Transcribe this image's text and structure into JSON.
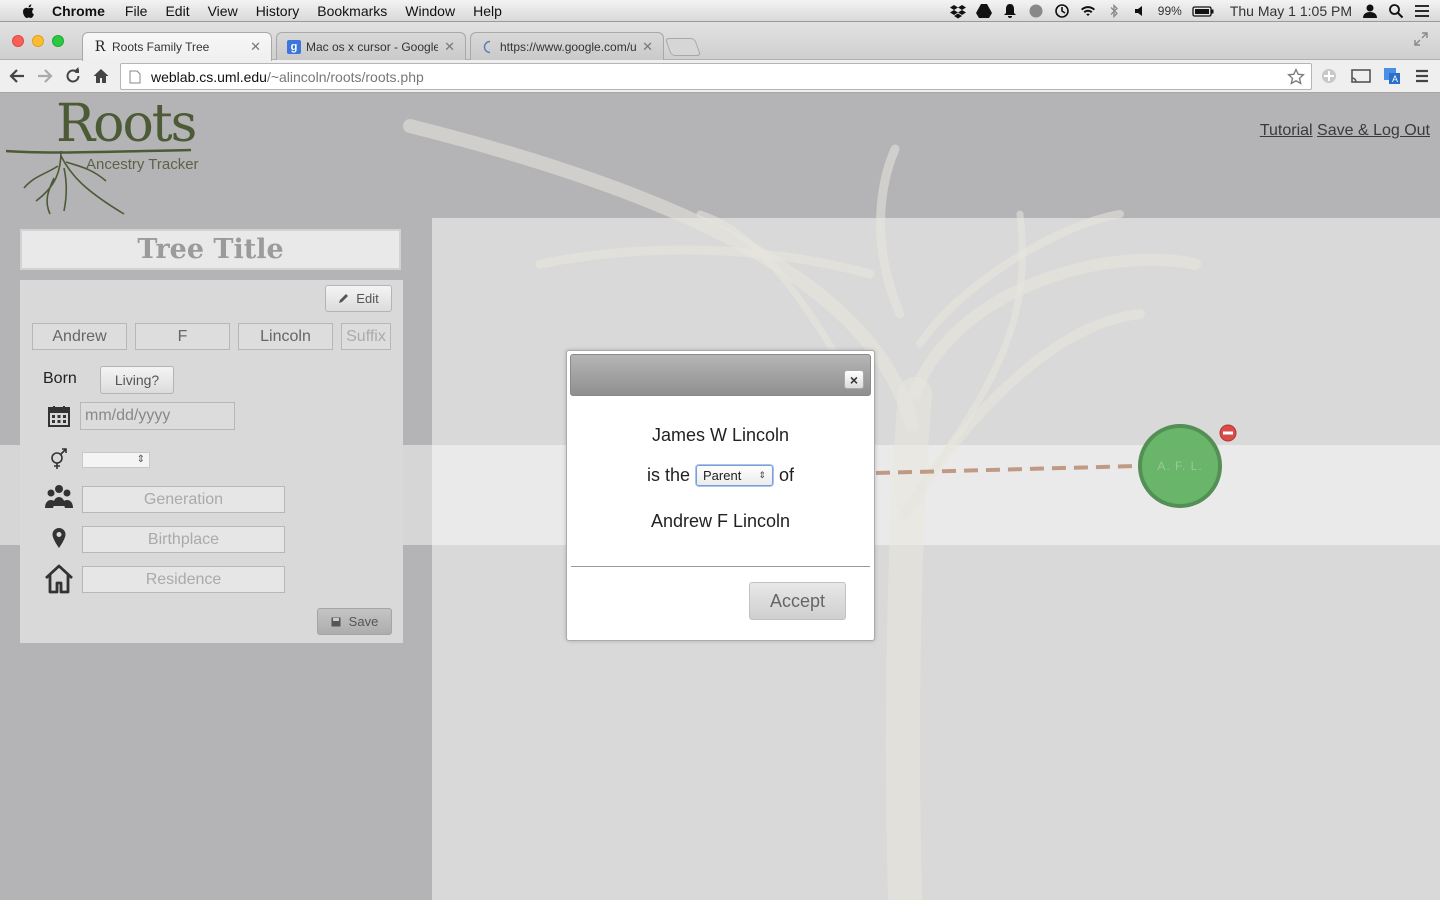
{
  "menubar": {
    "app_name": "Chrome",
    "items": [
      "File",
      "Edit",
      "View",
      "History",
      "Bookmarks",
      "Window",
      "Help"
    ],
    "battery": "99%",
    "clock": "Thu May 1  1:05 PM"
  },
  "tabs": [
    {
      "label": "Roots Family Tree",
      "favicon": "R"
    },
    {
      "label": "Mac os x cursor - Google S",
      "favicon": "g"
    },
    {
      "label": "https://www.google.com/u",
      "favicon": "loading"
    }
  ],
  "address": {
    "host": "weblab.cs.uml.edu",
    "path": "/~alincoln/roots/roots.php"
  },
  "site": {
    "logo_title": "Roots",
    "logo_subtitle": "Ancestry Tracker",
    "tutorial_link": "Tutorial",
    "logout_link": "Save & Log Out"
  },
  "tree_title": "Tree Title",
  "person_panel": {
    "edit_label": "Edit",
    "first_name": "Andrew",
    "middle_name": "F",
    "last_name": "Lincoln",
    "suffix_placeholder": "Suffix",
    "born_label": "Born",
    "living_label": "Living?",
    "date_placeholder": "mm/dd/yyyy",
    "generation_placeholder": "Generation",
    "birthplace_placeholder": "Birthplace",
    "residence_placeholder": "Residence",
    "save_label": "Save"
  },
  "node": {
    "initials": "A. F. L.",
    "color": "#69b56a"
  },
  "modal": {
    "close_label": "×",
    "person1": "James W Lincoln",
    "is_the": "is the",
    "relation": "Parent",
    "of": "of",
    "person2": "Andrew F Lincoln",
    "accept_label": "Accept"
  }
}
